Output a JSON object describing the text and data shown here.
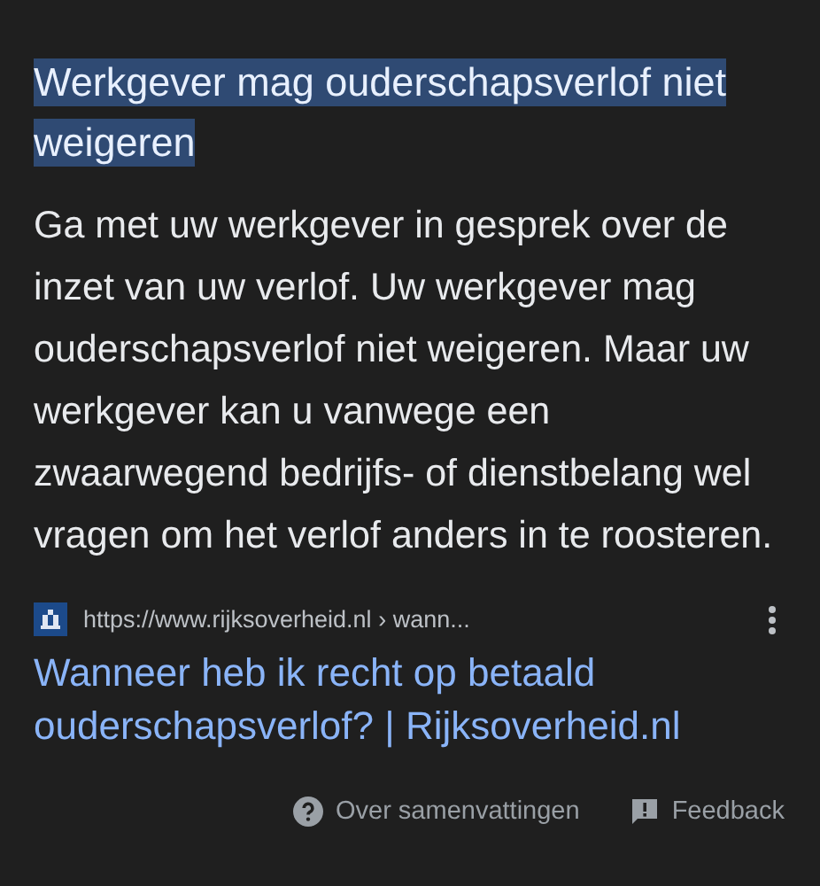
{
  "heading": {
    "text": "Werkgever mag ouderschapsverlof niet weigeren",
    "highlighted": true
  },
  "summary": "Ga met uw werkgever in gesprek over de inzet van uw verlof. Uw werkgever mag ouderschapsverlof niet weigeren. Maar uw werkgever kan u vanwege een zwaarwegend bedrijfs- of dienstbelang wel vragen om het verlof anders in te roosteren.",
  "source": {
    "url": "https://www.rijksoverheid.nl",
    "path": "› wann...",
    "title": "Wanneer heb ik recht op betaald ouderschapsverlof? | Rijksoverheid.nl"
  },
  "footer": [
    {
      "kind": "help",
      "label": "Over samenvattingen"
    },
    {
      "kind": "feedback",
      "label": "Feedback"
    }
  ]
}
